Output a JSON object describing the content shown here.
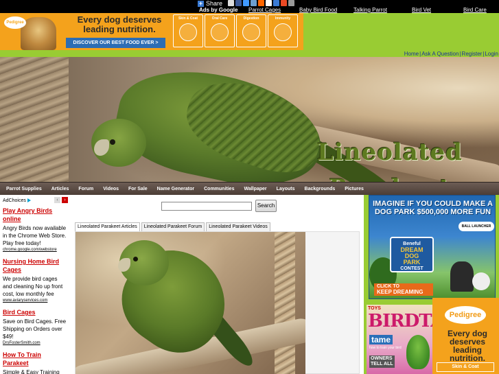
{
  "topbar": {
    "share_label": "Share",
    "ads_by": "Ads by Google",
    "ad_links": [
      "Parrot Cages",
      "Baby Bird Food",
      "Talking Parrot",
      "Bird Vet",
      "Bird Care"
    ]
  },
  "banner": {
    "logo": "Pedigree",
    "headline": "Every dog deserves leading nutrition.",
    "cta": "DISCOVER OUR BEST FOOD EVER >",
    "benefits": [
      "Skin & Coat",
      "Oral Care",
      "Digestion",
      "Immunity"
    ]
  },
  "toplinks": [
    "Home",
    "Ask A Question",
    "Register",
    "Login"
  ],
  "header": {
    "title_line1": "Lineolated",
    "title_line2": "Parakeet"
  },
  "menu": [
    "Parrot Supplies",
    "Articles",
    "Forum",
    "Videos",
    "For Sale",
    "Name Generator",
    "Communities",
    "Wallpaper",
    "Layouts",
    "Backgrounds",
    "Pictures"
  ],
  "left_ads": {
    "adchoices": "AdChoices",
    "items": [
      {
        "title": "Play Angry Birds online",
        "body": "Angry Birds now available in the Chrome Web Store. Play free today!",
        "url": "chrome.google.com/webstore"
      },
      {
        "title": "Nursing Home Bird Cages",
        "body": "We provide bird cages and cleaning No up front cost, low monthly fee",
        "url": "www.aviaryservices.com"
      },
      {
        "title": "Bird Cages",
        "body": "Save on Bird Cages. Free Shipping on Orders over $49!",
        "url": "DrsFosterSmith.com"
      },
      {
        "title": "How To Train Parakeet",
        "body": "Simple & Easy Training",
        "url": ""
      }
    ]
  },
  "search": {
    "value": "",
    "button": "Search"
  },
  "tabs": [
    "Lineolated Parakeet Articles",
    "Lineolated Parakeet Forum",
    "Lineolated Parakeet Videos"
  ],
  "right_ads": {
    "dogpark": {
      "headline": "IMAGINE IF YOU COULD MAKE A DOG PARK $500,000 MORE FUN",
      "launcher": "BALL LAUNCHER",
      "sign_brand": "Beneful",
      "sign_l1": "DREAM",
      "sign_l2": "DOG",
      "sign_l3": "PARK",
      "sign_l4": "CONTEST",
      "cta_l1": "CLICK TO",
      "cta_l2": "KEEP DREAMING"
    },
    "birdtalk": {
      "toys": "TOYS",
      "title": "BIRDTALK",
      "tame": "tame",
      "sub": "how to train your bird",
      "owners_l1": "OWNERS",
      "owners_l2": "TELL ALL"
    },
    "pedigree": {
      "logo": "Pedigree",
      "text": "Every dog deserves leading nutrition.",
      "skin": "Skin & Coat"
    }
  }
}
